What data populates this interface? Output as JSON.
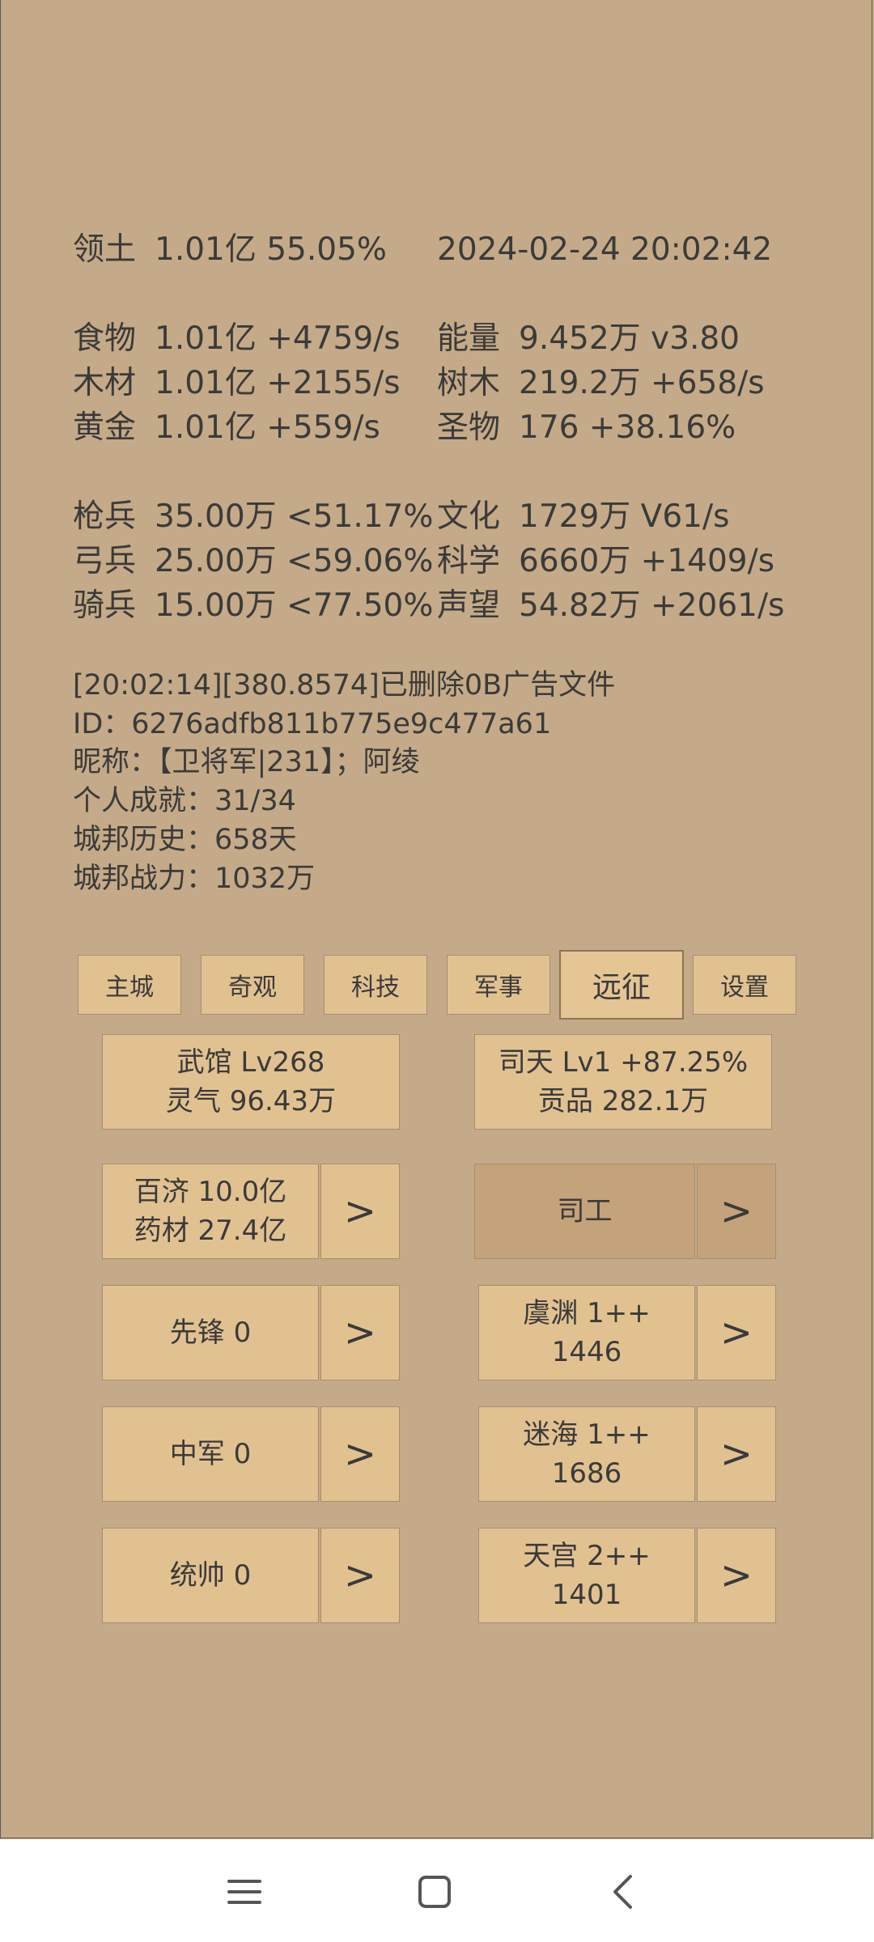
{
  "header": {
    "territory_label": "领土",
    "territory_value": "1.01亿 55.05%",
    "datetime": "2024-02-24 20:02:42"
  },
  "resources_left": [
    {
      "label": "食物",
      "value": "1.01亿 +4759/s"
    },
    {
      "label": "木材",
      "value": "1.01亿 +2155/s"
    },
    {
      "label": "黄金",
      "value": "1.01亿 +559/s"
    }
  ],
  "resources_right": [
    {
      "label": "能量",
      "value": "9.452万  v3.80"
    },
    {
      "label": "树木",
      "value": "219.2万 +658/s"
    },
    {
      "label": "圣物",
      "value": "176 +38.16%"
    }
  ],
  "army_left": [
    {
      "label": "枪兵",
      "value": "35.00万 <51.17%"
    },
    {
      "label": "弓兵",
      "value": "25.00万 <59.06%"
    },
    {
      "label": "骑兵",
      "value": "15.00万 <77.50%"
    }
  ],
  "army_right": [
    {
      "label": "文化",
      "value": "1729万 V61/s"
    },
    {
      "label": "科学",
      "value": "6660万 +1409/s"
    },
    {
      "label": "声望",
      "value": "54.82万 +2061/s"
    }
  ],
  "log": {
    "message": "[20:02:14][380.8574]已删除0B广告文件",
    "id_line": "ID：6276adfb811b775e9c477a61",
    "nickname_line": "昵称：【卫将军|231】；阿绫",
    "achievements_line": "个人成就：31/34",
    "history_line": "城邦历史：658天",
    "power_line": "城邦战力：1032万"
  },
  "tabs": [
    "主城",
    "奇观",
    "科技",
    "军事",
    "远征",
    "设置"
  ],
  "active_tab": "远征",
  "cards": {
    "wuguan": {
      "line1": "武馆 Lv268",
      "line2": "灵气 96.43万"
    },
    "sitian": {
      "line1": "司天 Lv1 +87.25%",
      "line2": "贡品 282.1万"
    },
    "baiji": {
      "line1": "百济  10.0亿",
      "line2": "药材 27.4亿"
    },
    "sigong": {
      "line1": "司工"
    },
    "xianfeng": {
      "line1": "先锋  0"
    },
    "zhongjun": {
      "line1": "中军  0"
    },
    "tongshuai": {
      "line1": "统帅  0"
    },
    "yuyuan": {
      "line1": "虞渊  1++",
      "line2": "1446"
    },
    "mihai": {
      "line1": "迷海  1++",
      "line2": "1686"
    },
    "tiangong": {
      "line1": "天宫  2++",
      "line2": "1401"
    }
  },
  "arrow_label": ">",
  "icons": {
    "menu": "menu-icon",
    "home": "home-icon",
    "back": "back-icon"
  }
}
